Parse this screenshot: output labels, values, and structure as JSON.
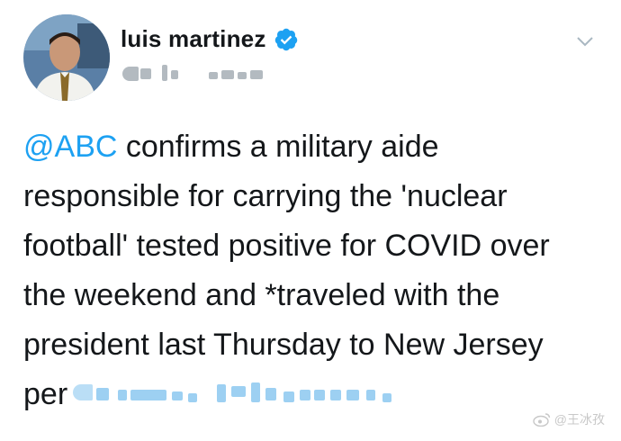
{
  "author": {
    "display_name": "luis martinez",
    "verified": true
  },
  "tweet": {
    "mention": "@ABC",
    "text_line_1": " confirms a military aide",
    "text_line_2": "responsible for carrying the 'nuclear",
    "text_line_3": "football' tested positive for COVID over",
    "text_line_4": "the weekend and *traveled with the",
    "text_line_5": "president last Thursday to New Jersey",
    "text_line_6": "per"
  },
  "icons": {
    "verified": "verified-badge-icon",
    "more": "chevron-down-icon",
    "watermark_logo": "weibo-logo-icon"
  },
  "watermark": {
    "text": "@王冰孜"
  },
  "colors": {
    "accent": "#1da1f2",
    "text": "#14171a"
  }
}
